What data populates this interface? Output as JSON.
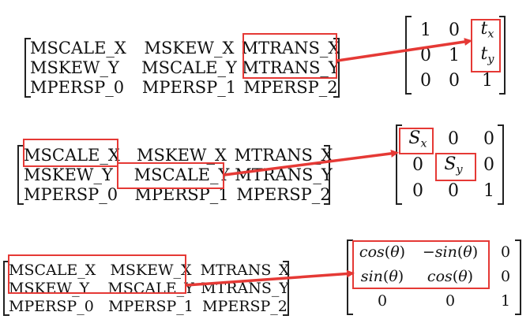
{
  "colors": {
    "highlight": "#e53935",
    "text": "#111111",
    "bracket": "#222222"
  },
  "panels": [
    {
      "symbolic": [
        [
          "MSCALE_X",
          "MSKEW_X",
          "MTRANS_X"
        ],
        [
          "MSKEW_Y",
          "MSCALE_Y",
          "MTRANS_Y"
        ],
        [
          "MPERSP_0",
          "MPERSP_1",
          "MPERSP_2"
        ]
      ],
      "numeric": [
        [
          "1",
          "0",
          "t_x"
        ],
        [
          "0",
          "1",
          "t_y"
        ],
        [
          "0",
          "0",
          "1"
        ]
      ]
    },
    {
      "symbolic": [
        [
          "MSCALE_X",
          "MSKEW_X",
          "MTRANS_X"
        ],
        [
          "MSKEW_Y",
          "MSCALE_Y",
          "MTRANS_Y"
        ],
        [
          "MPERSP_0",
          "MPERSP_1",
          "MPERSP_2"
        ]
      ],
      "numeric": [
        [
          "S_x",
          "0",
          "0"
        ],
        [
          "0",
          "S_y",
          "0"
        ],
        [
          "0",
          "0",
          "1"
        ]
      ]
    },
    {
      "symbolic": [
        [
          "MSCALE_X",
          "MSKEW_X",
          "MTRANS_X"
        ],
        [
          "MSKEW_Y",
          "MSCALE_Y",
          "MTRANS_Y"
        ],
        [
          "MPERSP_0",
          "MPERSP_1",
          "MPERSP_2"
        ]
      ],
      "numeric": [
        [
          "cos(θ)",
          "−sin(θ)",
          "0"
        ],
        [
          "sin(θ)",
          "cos(θ)",
          "0"
        ],
        [
          "0",
          "0",
          "1"
        ]
      ]
    }
  ]
}
